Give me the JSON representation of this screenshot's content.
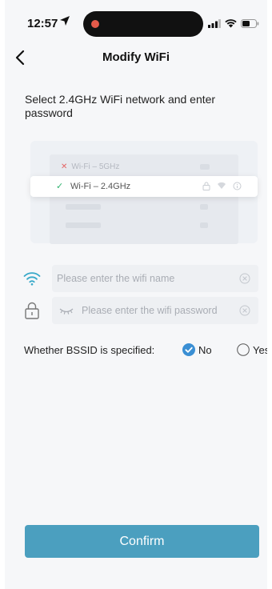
{
  "status_bar": {
    "time": "12:57"
  },
  "nav": {
    "title": "Modify WiFi"
  },
  "instruction": "Select 2.4GHz WiFi network and enter password",
  "illustration": {
    "row_5ghz": "Wi-Fi – 5GHz",
    "row_24ghz": "Wi-Fi – 2.4GHz"
  },
  "wifi_name": {
    "placeholder": "Please enter the wifi name",
    "value": ""
  },
  "wifi_password": {
    "placeholder": "Please enter the wifi password",
    "value": ""
  },
  "bssid": {
    "label": "Whether BSSID is specified:",
    "options": [
      {
        "label": "No",
        "selected": true
      },
      {
        "label": "Yes",
        "selected": false
      }
    ]
  },
  "confirm_label": "Confirm",
  "colors": {
    "accent": "#4b9fbf",
    "radio_selected": "#3a8fd4",
    "wifi_icon": "#38a9c9",
    "check": "#2fb36f",
    "error_x": "#e46565"
  }
}
